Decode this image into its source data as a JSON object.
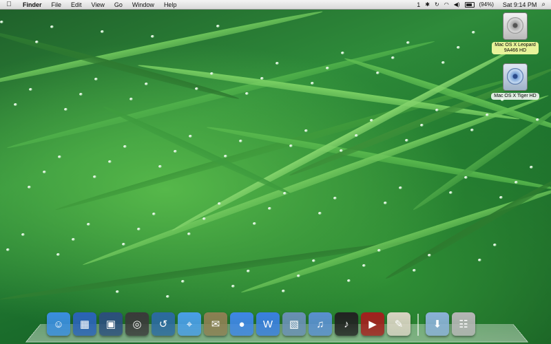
{
  "menubar": {
    "apple_icon": "apple-logo-icon",
    "app_name": "Finder",
    "menus": [
      "File",
      "Edit",
      "View",
      "Go",
      "Window",
      "Help"
    ],
    "status": {
      "spaces_number": "1",
      "battery_percent": "(94%)",
      "clock": "Sat 9:14 PM"
    }
  },
  "desktop": {
    "icons": [
      {
        "label_line1": "Mac OS X Leopard",
        "label_line2": "9A466 HD",
        "icon": "hard-drive-icon",
        "selected": true
      },
      {
        "label_line1": "Mac OS X Tiger HD",
        "label_line2": "",
        "icon": "hard-drive-icon",
        "selected": false
      }
    ]
  },
  "dock": {
    "apps": [
      {
        "name": "finder-icon",
        "color": "#3b8ee0"
      },
      {
        "name": "dashboard-icon",
        "color": "#2b63b8"
      },
      {
        "name": "spaces-icon",
        "color": "#2c4f7d"
      },
      {
        "name": "activity-dial-icon",
        "color": "#3a3a3a"
      },
      {
        "name": "time-machine-icon",
        "color": "#2c6aa0"
      },
      {
        "name": "safari-compass-icon",
        "color": "#4a9ee8"
      },
      {
        "name": "mail-stamp-icon",
        "color": "#8d7f53"
      },
      {
        "name": "ichat-bubble-icon",
        "color": "#3f86e6"
      },
      {
        "name": "iweb-icon",
        "color": "#3a7fe0"
      },
      {
        "name": "iphoto-icon",
        "color": "#6a8fb5"
      },
      {
        "name": "itunes-icon",
        "color": "#5a8fd0"
      },
      {
        "name": "garageband-icon",
        "color": "#222222"
      },
      {
        "name": "dvd-player-icon",
        "color": "#a3201e"
      },
      {
        "name": "textedit-icon",
        "color": "#d9d3c3"
      },
      {
        "name": "downloads-folder-icon",
        "color": "#8bb1d8"
      },
      {
        "name": "trash-icon",
        "color": "#b6b6b6"
      }
    ]
  }
}
